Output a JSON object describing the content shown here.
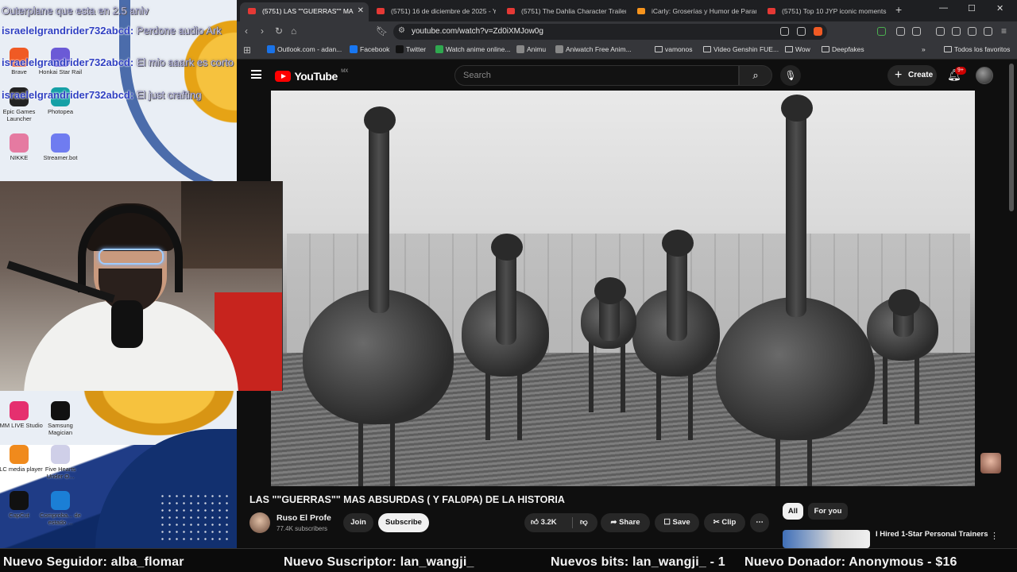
{
  "chat": [
    {
      "user": "",
      "message": "Outerplane que esta en 2.5 aniv"
    },
    {
      "user": "israelelgrandrider732abcd:",
      "message": "Perdone audio Ark"
    },
    {
      "user": "israelelgrandrider732abcd:",
      "message": "El mio aaark es corto"
    },
    {
      "user": "israelelgrandrider732abcd:",
      "message": "El just crafting"
    }
  ],
  "desktop_icons": [
    {
      "label": "Brave",
      "color": "#f05a24"
    },
    {
      "label": "Honkai Star Rail",
      "color": "#6b5ad6"
    },
    {
      "label": "Epic Games Launcher",
      "color": "#222222"
    },
    {
      "label": "Photopea",
      "color": "#15a0a6"
    },
    {
      "label": "NIKKE",
      "color": "#e57aa1"
    },
    {
      "label": "Streamer.bot",
      "color": "#6f7cf0"
    },
    {
      "label": "DMM LIVE Studio",
      "color": "#e5306f"
    },
    {
      "label": "Samsung Magician",
      "color": "#111111"
    },
    {
      "label": "VLC media player",
      "color": "#f08a1c"
    },
    {
      "label": "Five Hearts Under O...",
      "color": "#cfcfe8"
    },
    {
      "label": "CapCut",
      "color": "#111111"
    },
    {
      "label": "Comproba... de estado ...",
      "color": "#1b7fd6"
    }
  ],
  "browser": {
    "tabs": [
      {
        "label": "(5751) LAS \"\"GUERRAS\"\" MA",
        "active": true
      },
      {
        "label": "(5751) 16 de diciembre de 2025 - Yo",
        "active": false
      },
      {
        "label": "(5751) The Dahlia Character Trailer:",
        "active": false
      },
      {
        "label": "iCarly: Groserías y Humor de Paramo",
        "active": false
      },
      {
        "label": "(5751) Top 10 JYP iconic moments #",
        "active": false
      }
    ],
    "new_tab": "+",
    "window_min": "—",
    "window_max": "☐",
    "window_close": "✕",
    "url": "youtube.com/watch?v=Zd0iXMJow0g",
    "bookmarks": [
      {
        "label": "Outlook.com - adan...",
        "color": "#1a73e8"
      },
      {
        "label": "Facebook",
        "color": "#1877f2"
      },
      {
        "label": "Twitter",
        "color": "#111111"
      },
      {
        "label": "Watch anime online...",
        "color": "#2fa84f"
      },
      {
        "label": "Animu",
        "color": "#888888"
      },
      {
        "label": "Aniwatch Free Anim...",
        "color": "#888888"
      },
      {
        "label": "vamonos",
        "folder": true
      },
      {
        "label": "Video Genshin FUE...",
        "folder": true
      },
      {
        "label": "Wow",
        "folder": true
      },
      {
        "label": "Deepfakes",
        "folder": true
      }
    ],
    "bookmarks_overflow": "»",
    "all_bookmarks": "Todos los favoritos"
  },
  "youtube": {
    "logo_text": "YouTube",
    "country": "MX",
    "search_placeholder": "Search",
    "create_label": "Create",
    "notif_count": "9+",
    "video_title": "LAS \"\"GUERRAS\"\" MAS ABSURDAS ( Y FAL0PA) DE LA HISTORIA",
    "channel_name": "Ruso El Profe",
    "subscribers": "77.4K subscribers",
    "join_label": "Join",
    "subscribe_label": "Subscribe",
    "likes": "3.2K",
    "share_label": "Share",
    "save_label": "Save",
    "clip_label": "Clip",
    "chips": [
      "All",
      "For you"
    ],
    "rec_title": "I Hired 1-Star Personal Trainers"
  },
  "ticker": [
    "Nuevo Seguidor: alba_flomar",
    "Nuevo Suscriptor: lan_wangji_",
    "Nuevos bits: lan_wangji_ - 1",
    "Nuevo Donador: Anonymous - $16"
  ]
}
